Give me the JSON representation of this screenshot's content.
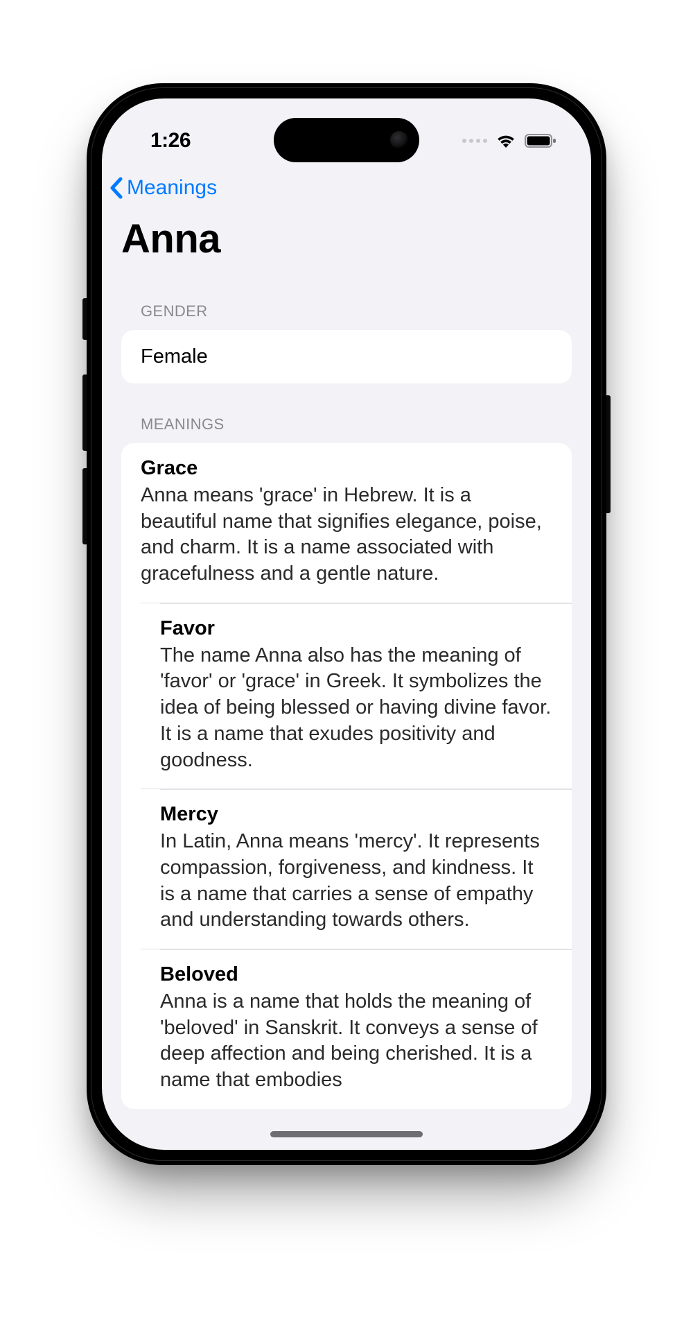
{
  "status": {
    "time": "1:26"
  },
  "nav": {
    "back_label": "Meanings"
  },
  "page": {
    "title": "Anna"
  },
  "sections": {
    "gender": {
      "header": "GENDER",
      "value": "Female"
    },
    "meanings": {
      "header": "MEANINGS",
      "items": [
        {
          "title": "Grace",
          "body": "Anna means 'grace' in Hebrew. It is a beautiful name that signifies elegance, poise, and charm. It is a name associated with gracefulness and a gentle nature."
        },
        {
          "title": "Favor",
          "body": "The name Anna also has the meaning of 'favor' or 'grace' in Greek. It symbolizes the idea of being blessed or having divine favor. It is a name that exudes positivity and goodness."
        },
        {
          "title": "Mercy",
          "body": "In Latin, Anna means 'mercy'. It represents compassion, forgiveness, and kindness. It is a name that carries a sense of empathy and understanding towards others."
        },
        {
          "title": "Beloved",
          "body": "Anna is a name that holds the meaning of 'beloved' in Sanskrit. It conveys a sense of deep affection and being cherished. It is a name that embodies"
        }
      ]
    }
  }
}
